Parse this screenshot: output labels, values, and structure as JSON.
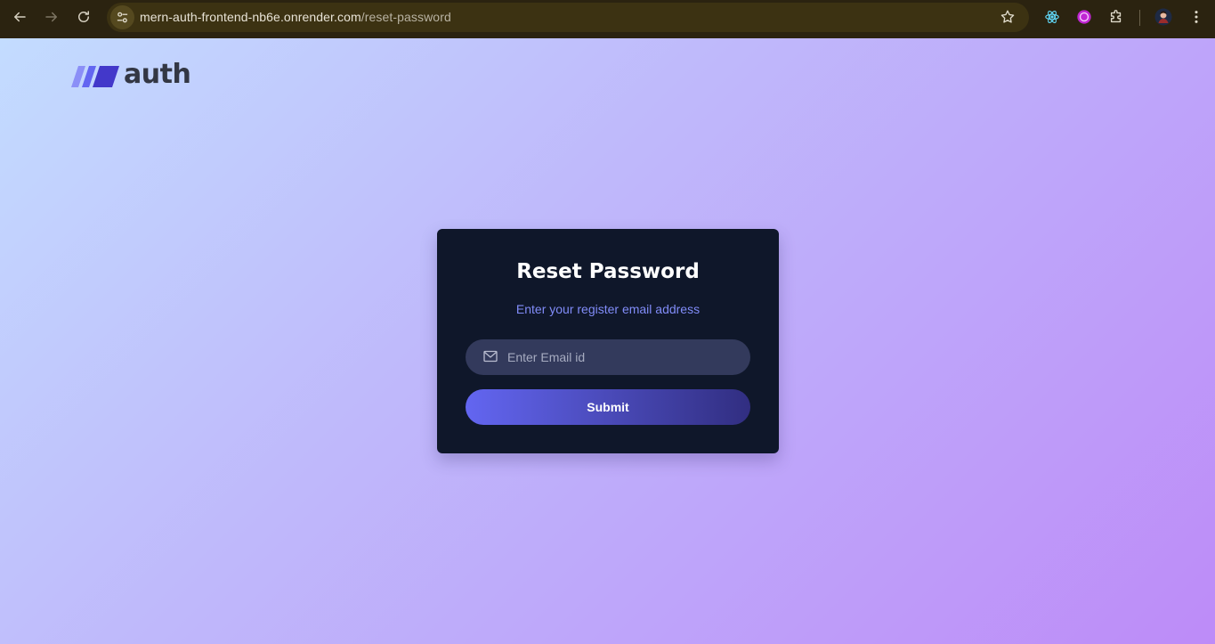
{
  "browser": {
    "url_host": "mern-auth-frontend-nb6e.onrender.com",
    "url_path": "/reset-password"
  },
  "logo": {
    "text": "auth"
  },
  "card": {
    "title": "Reset Password",
    "subtitle": "Enter your register email address",
    "email_placeholder": "Enter Email id",
    "email_value": "",
    "submit_label": "Submit"
  }
}
